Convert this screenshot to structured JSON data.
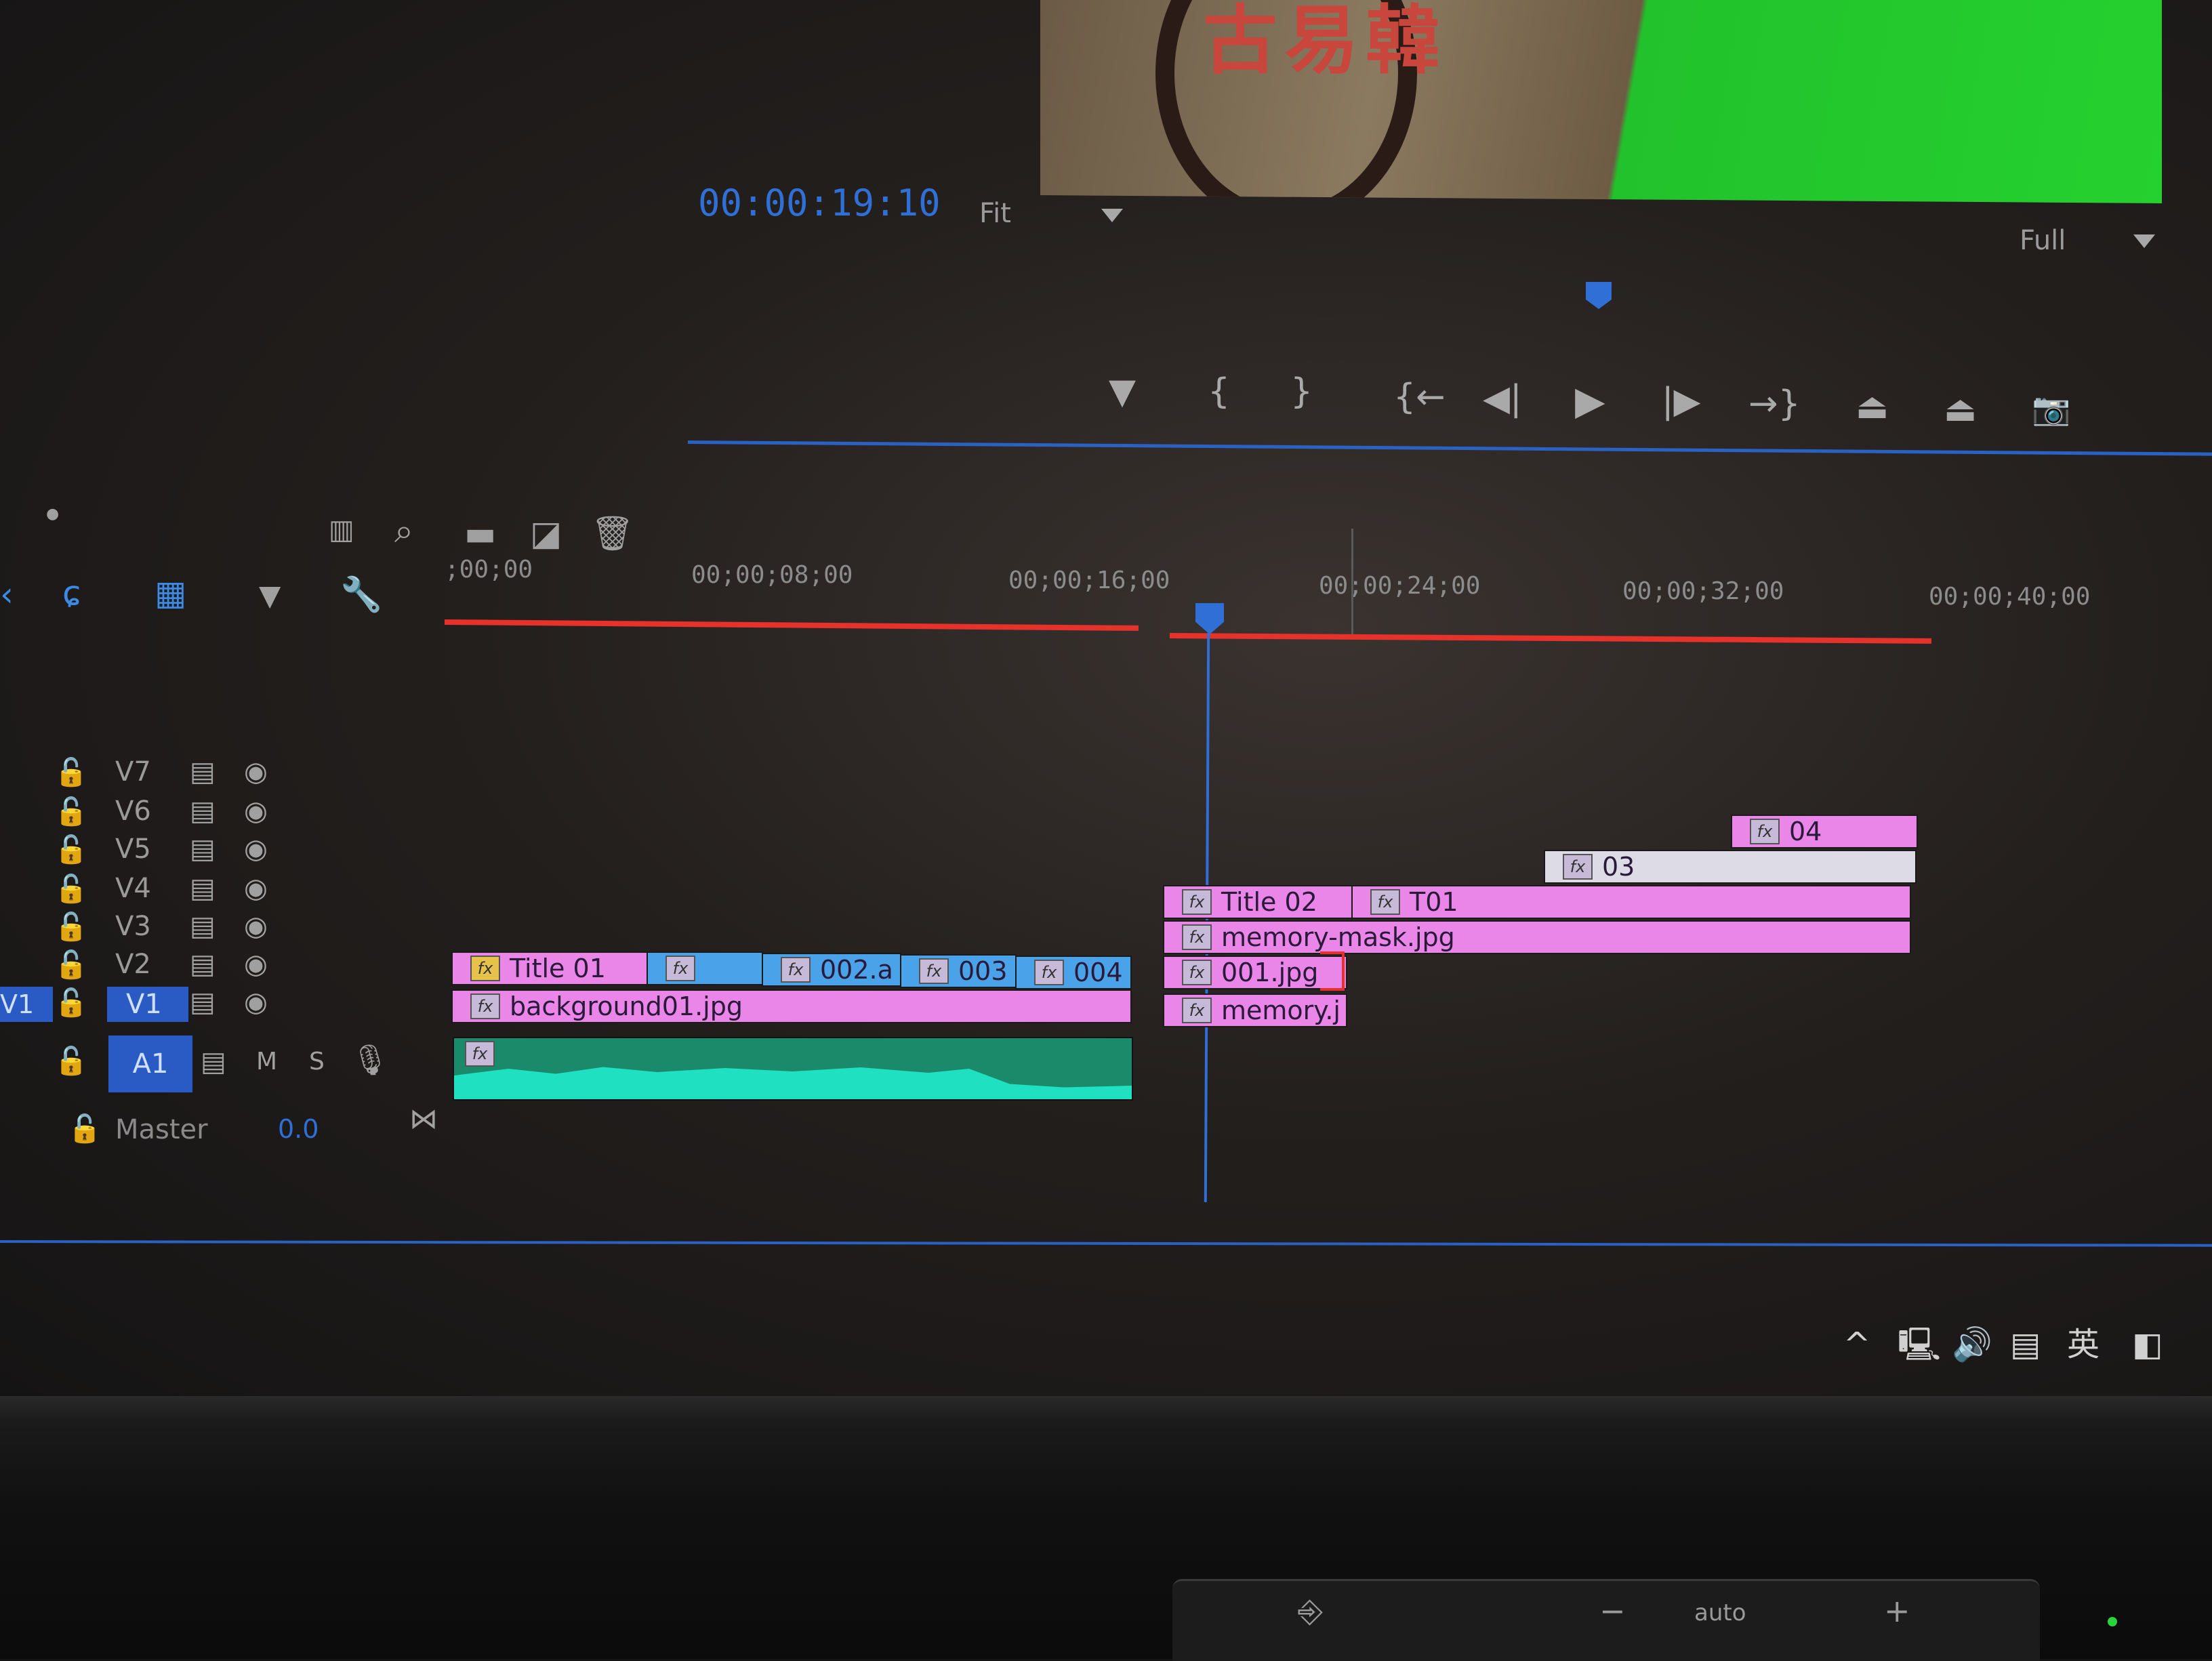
{
  "program_monitor": {
    "timecode": "00:00:19:10",
    "zoom": "Fit",
    "resolution": "Full",
    "preview_text": "古易韓"
  },
  "transport_icons": {
    "marker": "▼",
    "mark_in": "{",
    "mark_out": "}",
    "go_to_in": "{←",
    "step_back": "◀|",
    "play": "▶",
    "step_forward": "|▶",
    "go_to_out": "→}",
    "lift": "⏏",
    "extract": "⏏",
    "export_frame": "📷"
  },
  "timeline": {
    "ruler": [
      "00;00;08;00",
      "00;00;16;00",
      "00;00;24;00",
      "00;00;32;00",
      "00;00;40;00"
    ],
    "ruler_partial": ";00;00",
    "tracks": [
      {
        "name": "V7"
      },
      {
        "name": "V6"
      },
      {
        "name": "V5"
      },
      {
        "name": "V4"
      },
      {
        "name": "V3"
      },
      {
        "name": "V2"
      },
      {
        "name": "V1"
      }
    ],
    "source_v1": "V1",
    "audio_track": {
      "name": "A1",
      "mute": "M",
      "solo": "S"
    },
    "master": {
      "label": "Master",
      "value": "0.0"
    },
    "clips": {
      "title01": "Title 01",
      "c002": "002.a",
      "c003": "003",
      "c004": "004",
      "background": "background01.jpg",
      "title02": "Title 02",
      "t01": "T01",
      "memory_mask": "memory-mask.jpg",
      "c001": "001.jpg",
      "memory": "memory.j",
      "c03": "03",
      "c04": "04",
      "fx": "fx"
    }
  },
  "taskbar": {
    "ime": "英"
  },
  "bezel": {
    "auto": "auto",
    "minus": "−",
    "plus": "+"
  }
}
